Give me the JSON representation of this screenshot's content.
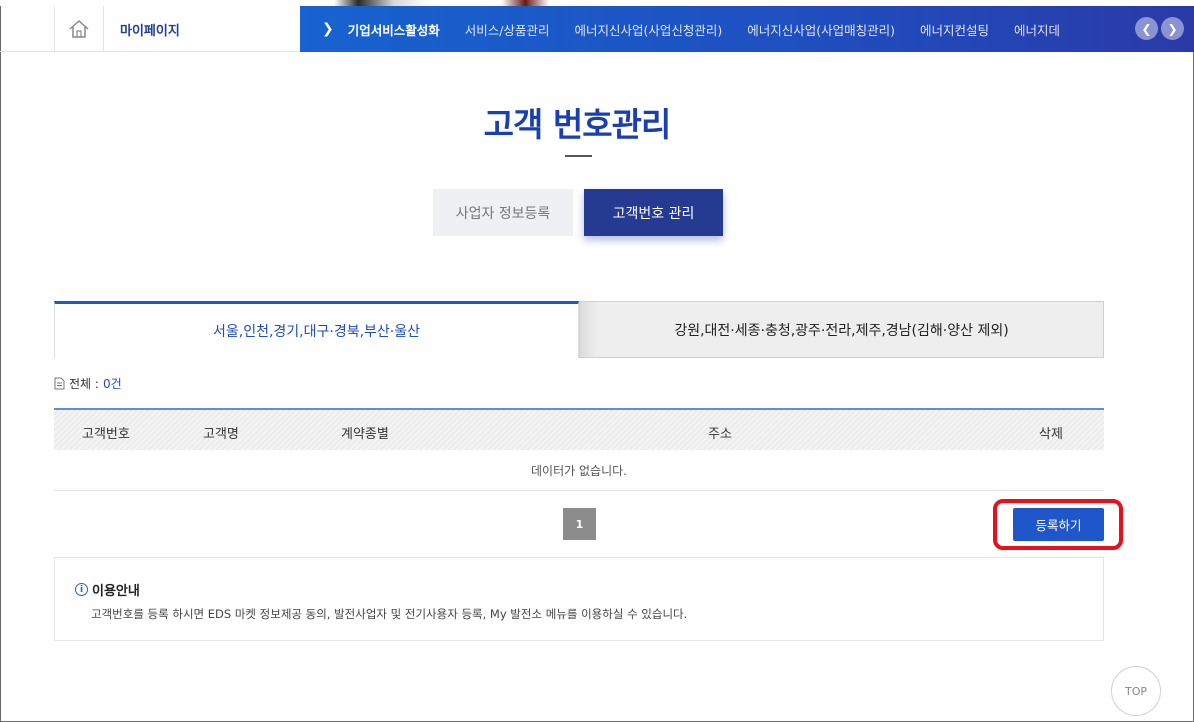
{
  "nav": {
    "mypage_label": "마이페이지",
    "items": [
      {
        "label": "기업서비스활성화"
      },
      {
        "label": "서비스/상품관리"
      },
      {
        "label": "에너지신사업(사업신청관리)"
      },
      {
        "label": "에너지신사업(사업매칭관리)"
      },
      {
        "label": "에너지컨설팅"
      },
      {
        "label": "에너지데"
      }
    ]
  },
  "page": {
    "title": "고객 번호관리"
  },
  "segments": {
    "business_info": "사업자 정보등록",
    "customer_number": "고객번호 관리"
  },
  "region_tabs": {
    "tab1": "서울,인천,경기,대구·경북,부산·울산",
    "tab2": "강원,대전·세종·충청,광주·전라,제주,경남(김해·양산 제외)"
  },
  "count": {
    "label": "전체 :",
    "value": "0건"
  },
  "table": {
    "headers": [
      "고객번호",
      "고객명",
      "계약종별",
      "주소",
      "삭제"
    ],
    "empty_message": "데이터가 없습니다."
  },
  "pagination": {
    "current": "1"
  },
  "actions": {
    "register": "등록하기"
  },
  "guide": {
    "title": "이용안내",
    "text": "고객번호를 등록 하시면 EDS 마켓 정보제공 동의, 발전사업자 및 전기사용자 등록, My 발전소 메뉴를 이용하실 수 있습니다."
  },
  "top_button": "TOP",
  "colors": {
    "accent": "#1f56c9",
    "nav_dark": "#253a91",
    "highlight": "#e8101b"
  }
}
